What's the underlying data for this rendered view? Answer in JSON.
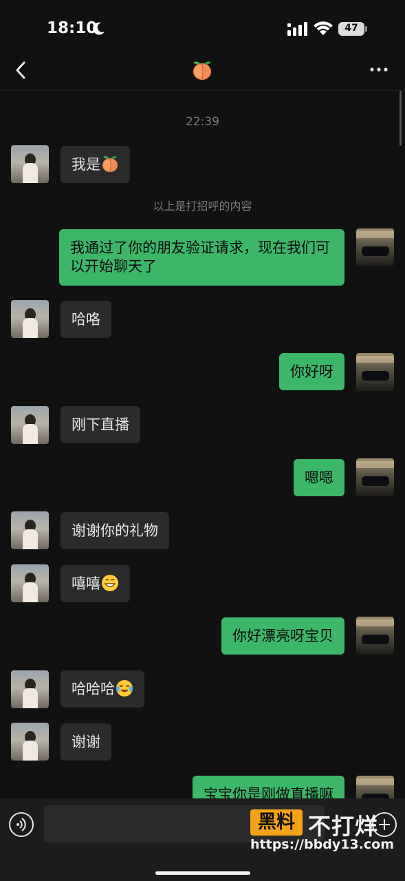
{
  "status_bar": {
    "time": "18:10",
    "battery": "47"
  },
  "nav": {
    "title_icon": "peach-emoji-icon",
    "more_icon": "more-dots-icon",
    "back_icon": "back-chevron-icon"
  },
  "chat": {
    "timestamp": "22:39",
    "system_note": "以上是打招呼的内容",
    "messages": [
      {
        "side": "in",
        "text": "我是",
        "emoji": "peach"
      },
      {
        "side": "out",
        "text": "我通过了你的朋友验证请求，现在我们可以开始聊天了"
      },
      {
        "side": "in",
        "text": "哈咯"
      },
      {
        "side": "out",
        "text": "你好呀"
      },
      {
        "side": "in",
        "text": "刚下直播"
      },
      {
        "side": "out",
        "text": "嗯嗯"
      },
      {
        "side": "in",
        "text": "谢谢你的礼物"
      },
      {
        "side": "in",
        "text": "嘻嘻",
        "emoji": "grin"
      },
      {
        "side": "out",
        "text": "你好漂亮呀宝贝"
      },
      {
        "side": "in",
        "text": "哈哈哈",
        "emoji": "tears-of-joy"
      },
      {
        "side": "in",
        "text": "谢谢"
      },
      {
        "side": "out",
        "text": "宝宝你是刚做直播嘛"
      }
    ]
  },
  "watermark": {
    "badge": "黑料",
    "name": "不打烊",
    "url": "https://bbdy13.com"
  }
}
